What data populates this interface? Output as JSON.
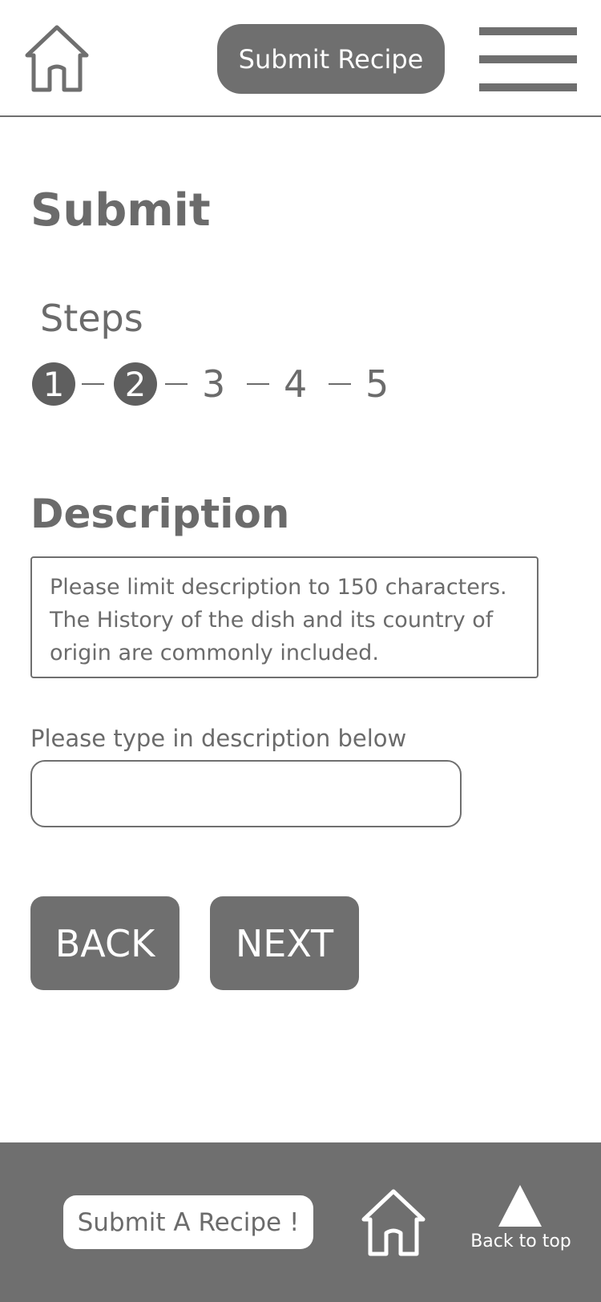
{
  "header": {
    "home_icon": "home-icon",
    "submit_label": "Submit Recipe",
    "menu_icon": "hamburger-menu-icon"
  },
  "page": {
    "title": "Submit",
    "steps_label": "Steps",
    "current_step": 2,
    "steps": [
      "1",
      "2",
      "3",
      "4",
      "5"
    ]
  },
  "description": {
    "heading": "Description",
    "hint": "Please limit description to 150 characters. The History of the dish and its country of origin are commonly included.",
    "input_label": "Please type in description below",
    "input_value": ""
  },
  "buttons": {
    "back": "BACK",
    "next": "NEXT"
  },
  "footer": {
    "submit_label": "Submit A Recipe !",
    "home_icon": "home-icon",
    "back_to_top_label": "Back to top",
    "back_to_top_icon": "triangle-up-icon"
  },
  "colors": {
    "primary_gray": "#6f6f6f",
    "text_gray": "#6b6b6b",
    "background": "#ffffff"
  }
}
